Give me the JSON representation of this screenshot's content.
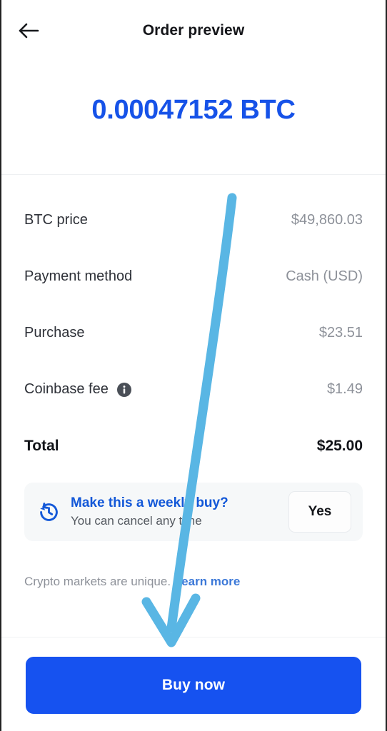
{
  "header": {
    "back_icon": "arrow-left-icon",
    "title": "Order preview"
  },
  "amount": {
    "value": "0.00047152 BTC",
    "color": "#1652e8"
  },
  "details": {
    "rows": [
      {
        "label": "BTC price",
        "value": "$49,860.03",
        "has_info": false
      },
      {
        "label": "Payment method",
        "value": "Cash (USD)",
        "has_info": false
      },
      {
        "label": "Purchase",
        "value": "$23.51",
        "has_info": false
      },
      {
        "label": "Coinbase fee",
        "value": "$1.49",
        "has_info": true,
        "info_icon": "info-icon"
      },
      {
        "label": "Total",
        "value": "$25.00",
        "has_info": false,
        "emphasis": true
      }
    ]
  },
  "recurring": {
    "icon": "clock-history-icon",
    "title": "Make this a weekly buy?",
    "subtitle": "You can cancel any time",
    "action_label": "Yes",
    "title_color": "#1358d8"
  },
  "disclaimer": {
    "text": "Crypto markets are unique.",
    "link_label": "Learn more",
    "link_color": "#3b78d8"
  },
  "cta": {
    "label": "Buy now",
    "color": "#1652f0"
  },
  "annotation": {
    "type": "arrow",
    "color": "#59b6e4",
    "points_from": "BTC price row",
    "points_to": "Buy now"
  }
}
